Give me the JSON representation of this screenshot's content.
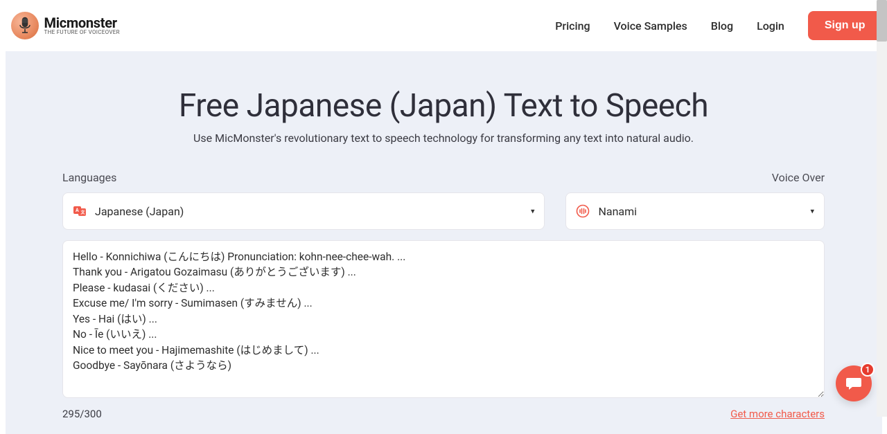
{
  "brand": {
    "name": "Micmonster",
    "tagline": "THE FUTURE OF VOICEOVER"
  },
  "nav": {
    "pricing": "Pricing",
    "samples": "Voice Samples",
    "blog": "Blog",
    "login": "Login",
    "signup": "Sign up"
  },
  "hero": {
    "title": "Free Japanese (Japan) Text to Speech",
    "subtitle": "Use MicMonster's revolutionary text to speech technology for transforming any text into natural audio."
  },
  "labels": {
    "languages": "Languages",
    "voiceover": "Voice Over"
  },
  "selects": {
    "language": "Japanese (Japan)",
    "voice": "Nanami"
  },
  "textarea": {
    "value": "Hello - Konnichiwa (こんにちは) Pronunciation: kohn-nee-chee-wah. ...\nThank you - Arigatou Gozaimasu (ありがとうございます) ...\nPlease - kudasai (ください) ...\nExcuse me/ I'm sorry - Sumimasen (すみません) ...\nYes - Hai (はい) ...\nNo - Īe (いいえ) ...\nNice to meet you - Hajimemashite (はじめまして) ...\nGoodbye - Sayōnara (さようなら)"
  },
  "footer": {
    "count": "295/300",
    "more": "Get more characters"
  },
  "chat": {
    "badge": "1"
  }
}
